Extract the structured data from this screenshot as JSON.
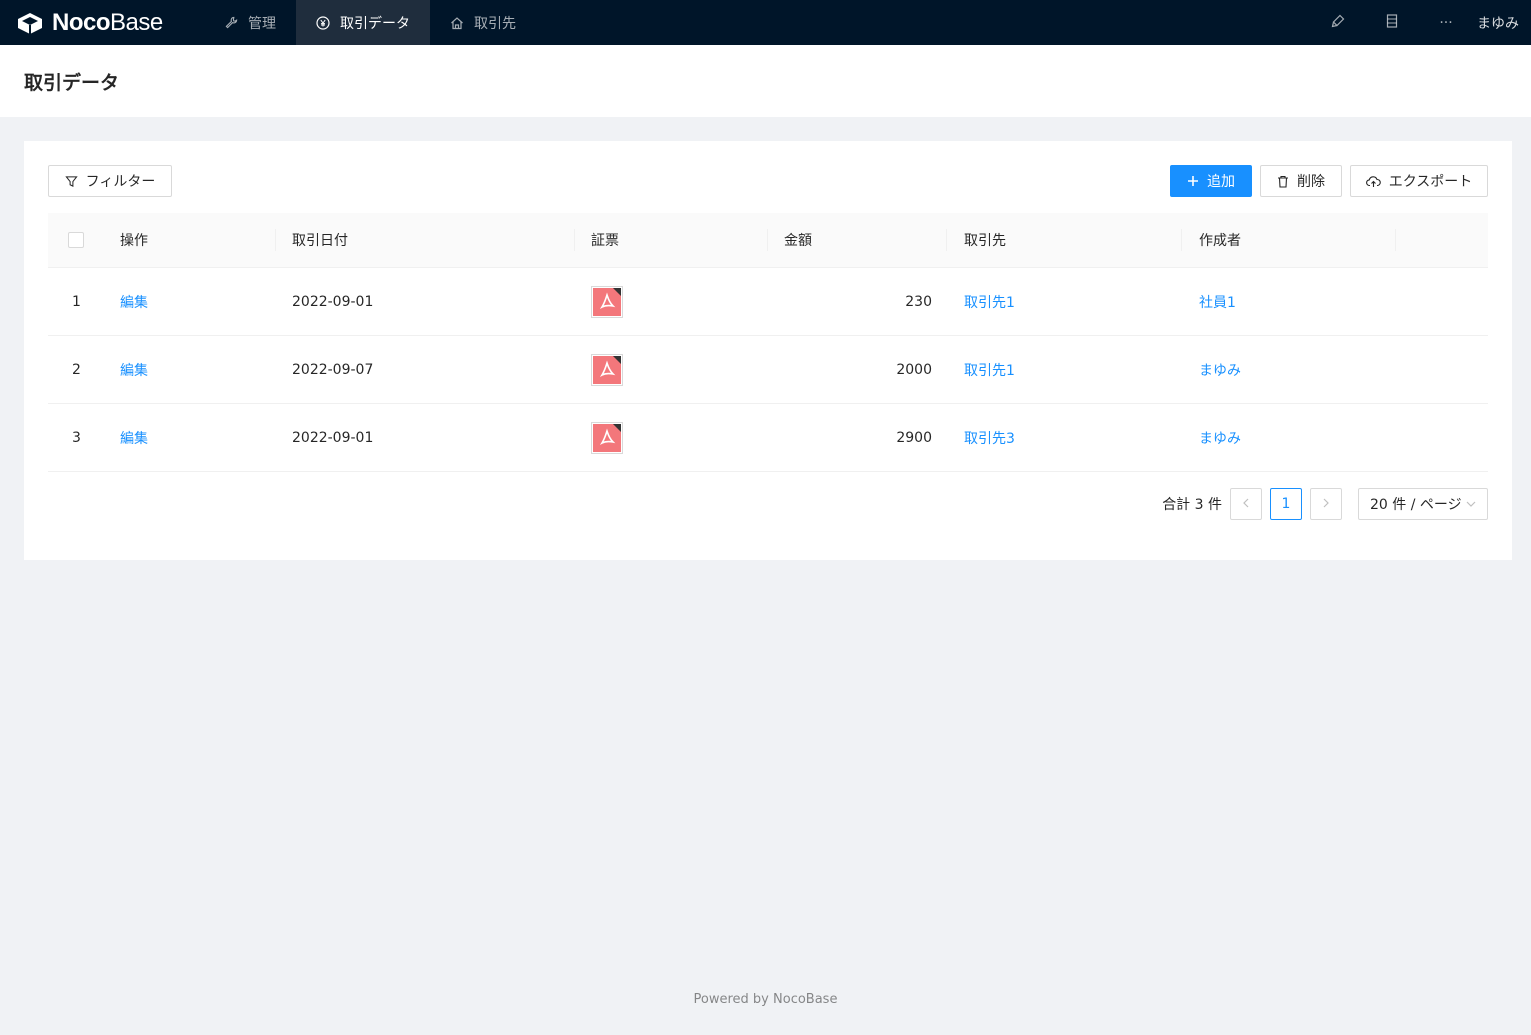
{
  "brand": {
    "name_strong": "Noco",
    "name_light": "Base"
  },
  "nav": {
    "items": [
      {
        "label": "管理",
        "icon": "wrench-icon"
      },
      {
        "label": "取引データ",
        "icon": "yen-circle-icon",
        "active": true
      },
      {
        "label": "取引先",
        "icon": "home-icon"
      }
    ],
    "tools": [
      "highlighter-icon",
      "ledger-icon",
      "ellipsis-icon"
    ],
    "ellipsis": "···",
    "user": "まゆみ"
  },
  "page": {
    "title": "取引データ"
  },
  "toolbar": {
    "filter_label": "フィルター",
    "add_label": "追加",
    "delete_label": "削除",
    "export_label": "エクスポート"
  },
  "table": {
    "columns": [
      "操作",
      "取引日付",
      "証票",
      "金額",
      "取引先",
      "作成者"
    ],
    "rows": [
      {
        "index": "1",
        "action": "編集",
        "date": "2022-09-01",
        "amount": "230",
        "partner": "取引先1",
        "creator": "社員1"
      },
      {
        "index": "2",
        "action": "編集",
        "date": "2022-09-07",
        "amount": "2000",
        "partner": "取引先1",
        "creator": "まゆみ"
      },
      {
        "index": "3",
        "action": "編集",
        "date": "2022-09-01",
        "amount": "2900",
        "partner": "取引先3",
        "creator": "まゆみ"
      }
    ]
  },
  "pagination": {
    "total": "合計 3 件",
    "current": "1",
    "page_size": "20 件 / ページ"
  },
  "footer": "Powered by NocoBase",
  "colors": {
    "header_bg": "#001529",
    "primary": "#1890ff",
    "pdf": "#f3777b"
  }
}
